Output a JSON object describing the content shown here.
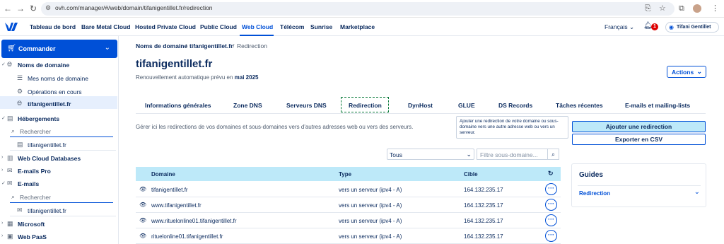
{
  "browser": {
    "url": "ovh.com/manager/#/web/domain/tifanigentillet.fr/redirection"
  },
  "topnav": {
    "items": [
      "Tableau de bord",
      "Bare Metal Cloud",
      "Hosted Private Cloud",
      "Public Cloud",
      "Web Cloud",
      "Télécom",
      "Sunrise",
      "Marketplace"
    ],
    "active": "Web Cloud",
    "language": "Français",
    "notif_count": "1",
    "user": "Tifani Gentillet"
  },
  "sidebar": {
    "commander": "Commander",
    "noms_de_domaine": "Noms de domaine",
    "mes_noms": "Mes noms de domaine",
    "operations": "Opérations en cours",
    "domain_active": "tifanigentillet.fr",
    "hebergements": "Hébergements",
    "search_placeholder": "Rechercher",
    "heb_item": "tifanigentillet.fr",
    "web_cloud_db": "Web Cloud Databases",
    "emails_pro": "E-mails Pro",
    "emails": "E-mails",
    "emails_search_placeholder": "Rechercher",
    "emails_item": "tifanigentillet.fr",
    "microsoft": "Microsoft",
    "web_paas": "Web PaaS"
  },
  "breadcrumb": {
    "part1": "Noms de domaine",
    "sep1": "/",
    "part2": "tifanigentillet.fr",
    "sep2": "/",
    "part3": "Redirection"
  },
  "header": {
    "title": "tifanigentillet.fr",
    "renew_prefix": "Renouvellement automatique prévu en",
    "renew_date": "mai 2025",
    "actions": "Actions"
  },
  "tabs": [
    "Informations générales",
    "Zone DNS",
    "Serveurs DNS",
    "Redirection",
    "DynHost",
    "GLUE",
    "DS Records",
    "Tâches récentes",
    "E-mails et mailing-lists"
  ],
  "active_tab": "Redirection",
  "content": {
    "description": "Gérer ici les redirections de vos domaines et sous-domaines vers d'autres adresses web ou vers des serveurs.",
    "tooltip": "Ajouter une redirection de votre domaine ou sous-domaine vers une autre adresse web ou vers un serveur.",
    "add_button": "Ajouter une redirection",
    "export_button": "Exporter en CSV",
    "select_value": "Tous",
    "filter_placeholder": "Filtre sous-domaine..."
  },
  "table": {
    "headers": [
      "Domaine",
      "Type",
      "Cible"
    ],
    "rows": [
      [
        "tifanigentillet.fr",
        "vers un serveur (ipv4 - A)",
        "164.132.235.17"
      ],
      [
        "www.tifanigentillet.fr",
        "vers un serveur (ipv4 - A)",
        "164.132.235.17"
      ],
      [
        "www.rituelonline01.tifanigentillet.fr",
        "vers un serveur (ipv4 - A)",
        "164.132.235.17"
      ],
      [
        "rituelonline01.tifanigentillet.fr",
        "vers un serveur (ipv4 - A)",
        "164.132.235.17"
      ]
    ]
  },
  "guides": {
    "title": "Guides",
    "link": "Redirection"
  },
  "colors": {
    "primary": "#0050d7",
    "navy": "#0a2a5e",
    "table_header": "#bde9f9"
  }
}
